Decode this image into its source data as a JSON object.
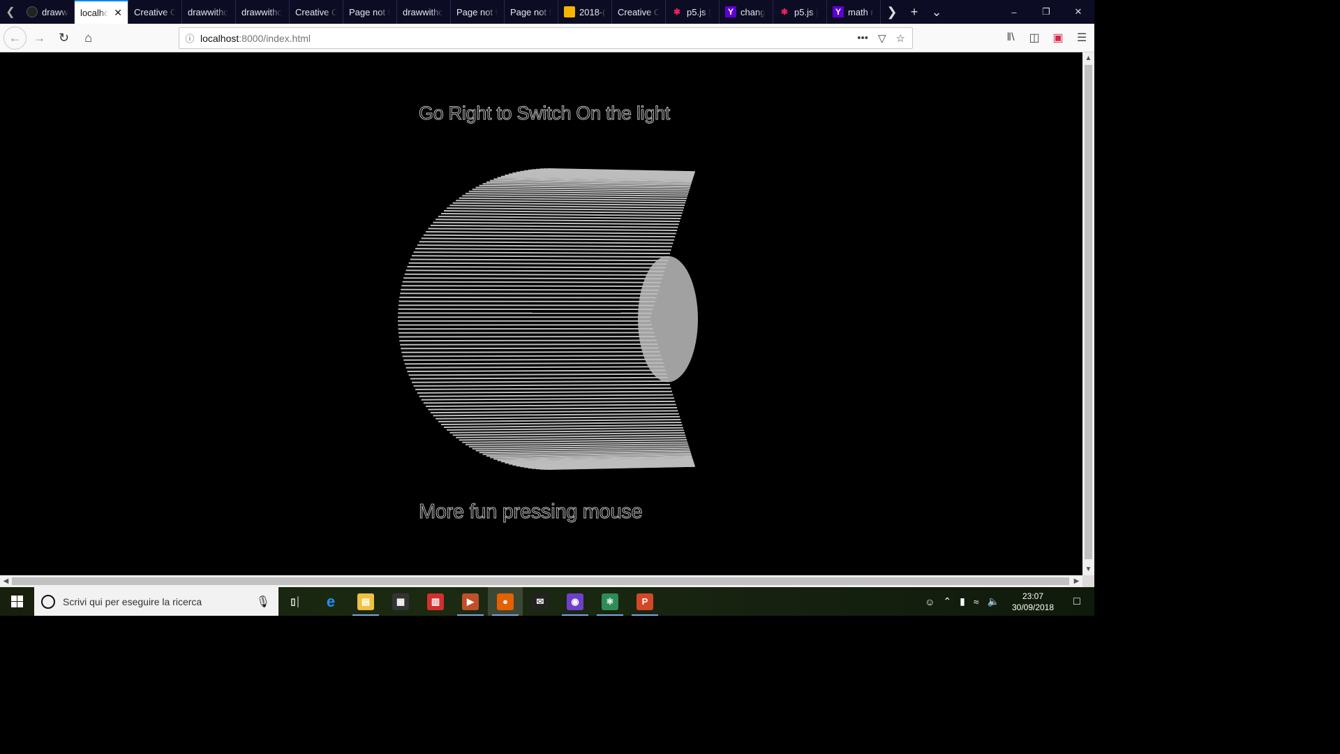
{
  "tabs": [
    {
      "label": "draww",
      "icon": "github-icon",
      "active": false
    },
    {
      "label": "localhc",
      "icon": "",
      "active": true
    },
    {
      "label": "Creative C",
      "icon": "",
      "active": false
    },
    {
      "label": "drawwithc",
      "icon": "",
      "active": false
    },
    {
      "label": "drawwithc",
      "icon": "",
      "active": false
    },
    {
      "label": "Creative C",
      "icon": "",
      "active": false
    },
    {
      "label": "Page not f",
      "icon": "",
      "active": false
    },
    {
      "label": "drawwithc",
      "icon": "",
      "active": false
    },
    {
      "label": "Page not f",
      "icon": "",
      "active": false
    },
    {
      "label": "Page not f",
      "icon": "",
      "active": false
    },
    {
      "label": "2018-(",
      "icon": "slides-icon",
      "active": false
    },
    {
      "label": "Creative C",
      "icon": "",
      "active": false
    },
    {
      "label": "p5.js |",
      "icon": "p5-icon",
      "active": false
    },
    {
      "label": "chang",
      "icon": "yahoo-icon",
      "active": false
    },
    {
      "label": "p5.js |",
      "icon": "p5-icon",
      "active": false
    },
    {
      "label": "math r",
      "icon": "yahoo-icon",
      "active": false
    }
  ],
  "colors": {
    "tab_active_accent": "#0a84ff",
    "sketch_stroke": "#bdbdbd",
    "p5_pink": "#ed225d",
    "yahoo_purple": "#5f01d1",
    "slides_yellow": "#f4b400"
  },
  "navbar": {
    "url_host": "localhost",
    "url_path": ":8000/index.html"
  },
  "sketch": {
    "title": "Go Right to Switch On the light",
    "subtitle": "More fun pressing mouse"
  },
  "taskbar": {
    "search_placeholder": "Scrivi qui per eseguire la ricerca",
    "time": "23:07",
    "date": "30/09/2018",
    "apps": [
      "task-view-icon",
      "edge-icon",
      "file-explorer-icon",
      "store-icon",
      "reader-icon",
      "git-gui-icon",
      "firefox-icon",
      "mail-icon",
      "github-desktop-icon",
      "atom-icon",
      "powerpoint-icon"
    ]
  }
}
